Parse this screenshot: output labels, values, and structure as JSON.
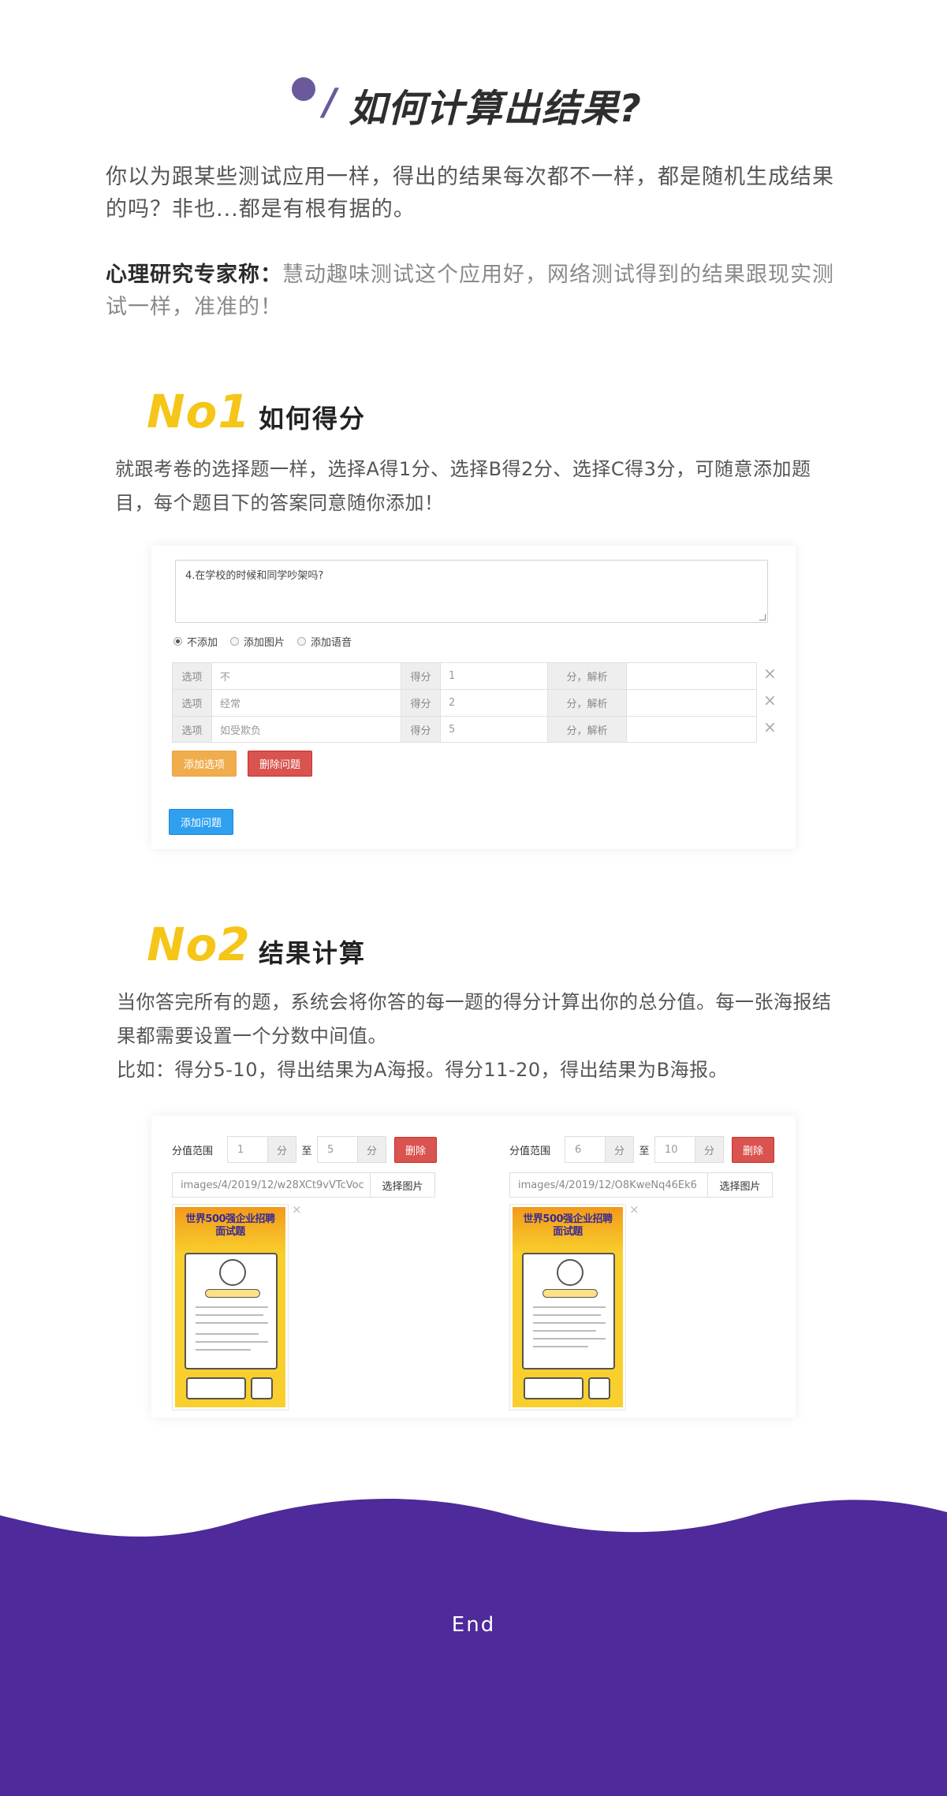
{
  "header": {
    "slash": "/",
    "title": "如何计算出结果?"
  },
  "intro": {
    "paragraph": "你以为跟某些测试应用一样，得出的结果每次都不一样，都是随机生成结果的吗？非也...都是有根有据的。",
    "expert_label": "心理研究专家称：",
    "expert_quote": "慧动趣味测试这个应用好，网络测试得到的结果跟现实测试一样，准准的！"
  },
  "section1": {
    "badge": "No1",
    "label": "如何得分",
    "text": "就跟考卷的选择题一样，选择A得1分、选择B得2分、选择C得3分，可随意添加题目，每个题目下的答案同意随你添加！",
    "editor": {
      "question": "4.在学校的时候和同学吵架吗?",
      "radios": [
        {
          "label": "不添加",
          "checked": true
        },
        {
          "label": "添加图片",
          "checked": false
        },
        {
          "label": "添加语音",
          "checked": false
        }
      ],
      "option_label": "选项",
      "score_label": "得分",
      "analysis_label": "分，解析",
      "options": [
        {
          "text": "不",
          "score": "1"
        },
        {
          "text": "经常",
          "score": "2"
        },
        {
          "text": "如受欺负",
          "score": "5"
        }
      ],
      "add_option_label": "添加选项",
      "delete_question_label": "删除问题",
      "add_question_label": "添加问题"
    }
  },
  "section2": {
    "badge": "No2",
    "label": "结果计算",
    "text_1": "当你答完所有的题，系统会将你答的每一题的得分计算出你的总分值。每一张海报结果都需要设置一个分数中间值。",
    "text_2": "比如：得分5-10，得出结果为A海报。得分11-20，得出结果为B海报。",
    "results": [
      {
        "range_label": "分值范围",
        "from": "1",
        "to": "5",
        "unit": "分",
        "to_label": "至",
        "delete_label": "删除",
        "path": "images/4/2019/12/w28XCt9vVTcVoc",
        "pick_label": "选择图片",
        "poster_title": "世界500强企业招聘面试题"
      },
      {
        "range_label": "分值范围",
        "from": "6",
        "to": "10",
        "unit": "分",
        "to_label": "至",
        "delete_label": "删除",
        "path": "images/4/2019/12/O8KweNq46Ek6",
        "pick_label": "选择图片",
        "poster_title": "世界500强企业招聘面试题"
      }
    ],
    "close_glyph": "×"
  },
  "footer": {
    "end": "End",
    "color": "#4e2a9a"
  },
  "colors": {
    "accent_yellow": "#f5c518",
    "title_purple": "#6b5a9b",
    "btn_orange": "#f0ad4e",
    "btn_red": "#d9534f",
    "btn_blue": "#2f9ff0"
  }
}
